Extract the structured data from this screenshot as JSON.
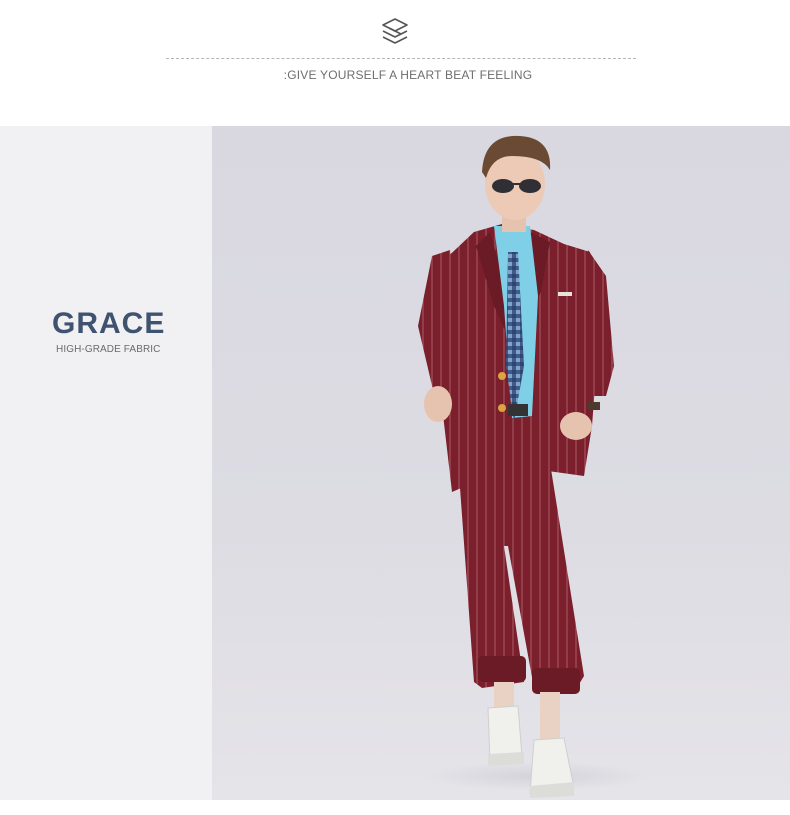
{
  "header": {
    "logo_icon": "layered-s-logo-icon",
    "tagline": ":GIVE YOURSELF A HEART BEAT FEELING"
  },
  "feature": {
    "title": "GRACE",
    "subtitle": "HIGH-GRADE FABRIC"
  },
  "photo": {
    "subject": "model-in-burgundy-pinstripe-suit"
  },
  "colors": {
    "title": "#3f5270",
    "panel_bg": "#f1f1f3",
    "suit": "#7a1f2b",
    "shirt": "#7fd0e6"
  }
}
